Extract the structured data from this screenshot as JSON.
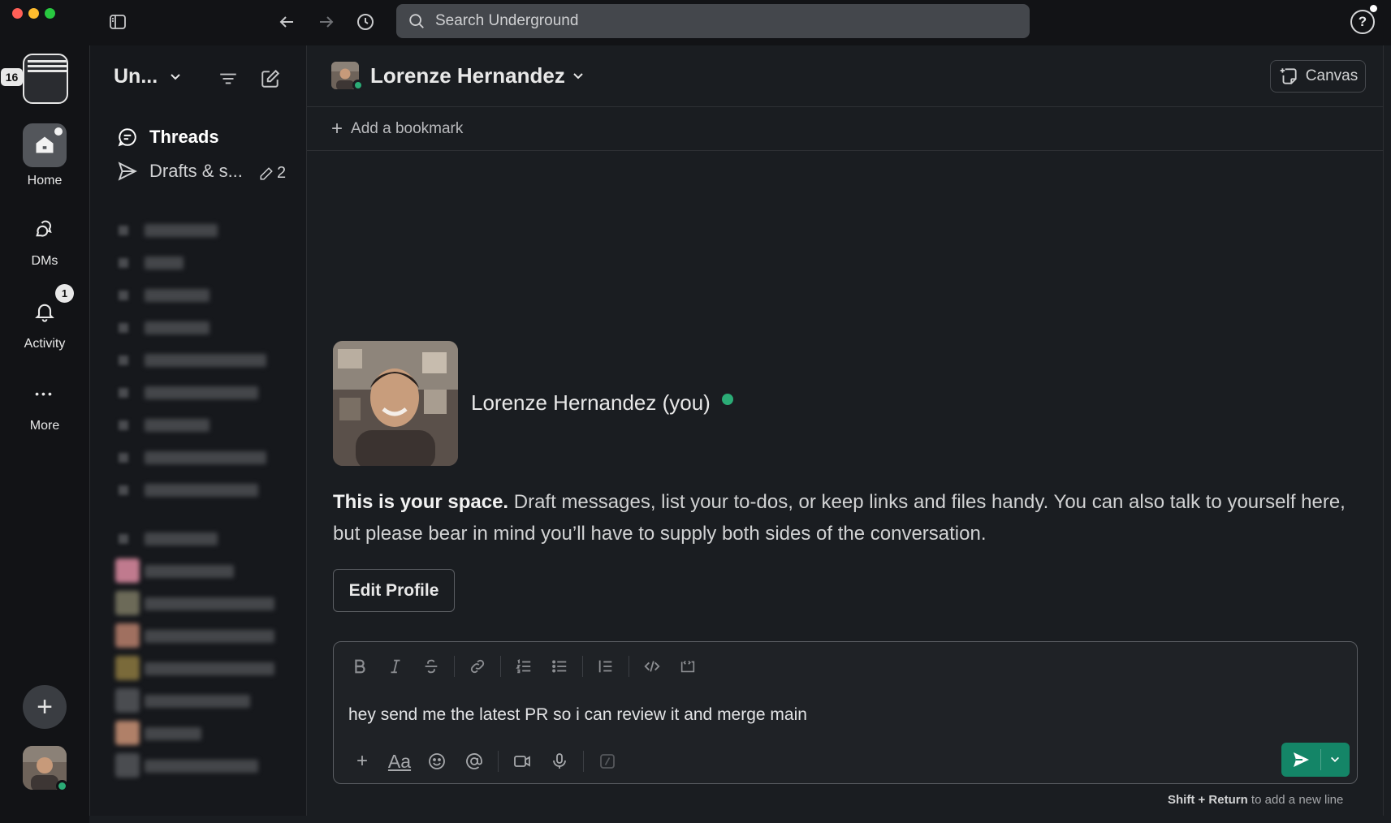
{
  "search": {
    "placeholder": "Search Underground"
  },
  "help": {
    "label": "?"
  },
  "workspace": {
    "badge": "16",
    "name": "Un..."
  },
  "rail": {
    "home": "Home",
    "dms": "DMs",
    "activity": "Activity",
    "activity_badge": "1",
    "more": "More",
    "more_glyph": "•••",
    "add_glyph": "+"
  },
  "sidebar": {
    "threads": "Threads",
    "drafts": "Drafts & s...",
    "drafts_count": "2"
  },
  "channel": {
    "name": "Lorenze Hernandez",
    "canvas": "Canvas",
    "bookmark_plus": "+",
    "bookmark": "Add a bookmark"
  },
  "intro": {
    "name": "Lorenze Hernandez (you)",
    "lead": "This is your space.",
    "body": " Draft messages, list your to-dos, or keep links and files handy. You can also talk to yourself here, but please bear in mind you’ll have to supply both sides of the conversation.",
    "edit_profile": "Edit Profile"
  },
  "composer": {
    "message": "hey send me the latest PR so i can review it and merge main",
    "plus": "+",
    "formatting": "Aa",
    "hint_keys": "Shift + Return",
    "hint_text": " to add a new line"
  },
  "colors": {
    "accent_green": "#148567",
    "status_online": "#2bac76",
    "background": "#1a1d21",
    "rail": "#121316"
  },
  "icons": [
    "sidebar-toggle-icon",
    "arrow-left-icon",
    "arrow-right-icon",
    "history-icon",
    "search-icon",
    "help-icon",
    "home-icon",
    "dms-icon",
    "bell-icon",
    "more-icon",
    "plus-icon",
    "filter-icon",
    "compose-icon",
    "threads-icon",
    "send-icon",
    "pencil-icon",
    "chevron-down-icon",
    "canvas-icon",
    "bold-icon",
    "italic-icon",
    "strikethrough-icon",
    "link-icon",
    "ordered-list-icon",
    "bullet-list-icon",
    "blockquote-icon",
    "code-icon",
    "code-block-icon",
    "emoji-icon",
    "mention-icon",
    "video-icon",
    "microphone-icon",
    "slash-command-icon"
  ]
}
